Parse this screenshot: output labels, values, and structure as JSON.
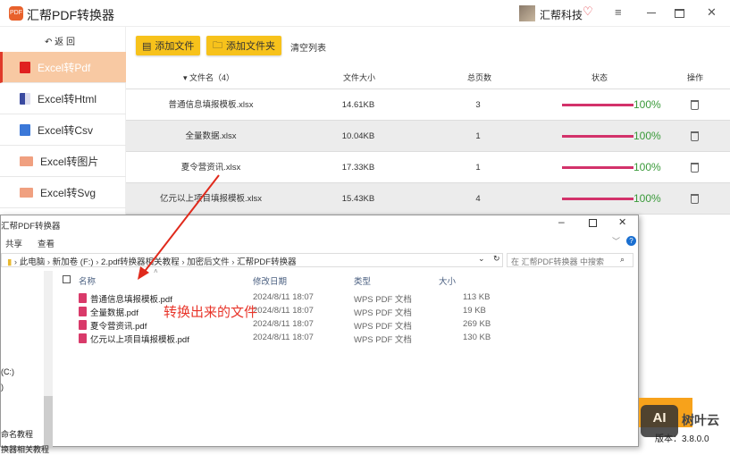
{
  "app": {
    "title": "汇帮PDF转换器",
    "logo_text": "PDF",
    "user": "汇帮科技",
    "back": "返 回"
  },
  "sidebar": {
    "items": [
      {
        "label": "Excel转Pdf",
        "selected": true
      },
      {
        "label": "Excel转Html"
      },
      {
        "label": "Excel转Csv"
      },
      {
        "label": "Excel转图片"
      },
      {
        "label": "Excel转Svg"
      }
    ]
  },
  "toolbar": {
    "add_file": "添加文件",
    "add_folder": "添加文件夹",
    "clear": "清空列表"
  },
  "table": {
    "headers": {
      "name": "▾ 文件名（4）",
      "size": "文件大小",
      "pages": "总页数",
      "status": "状态",
      "action": "操作"
    },
    "rows": [
      {
        "name": "普通信息填报模板.xlsx",
        "size": "14.61KB",
        "pages": "3",
        "progress": "100%"
      },
      {
        "name": "全量数据.xlsx",
        "size": "10.04KB",
        "pages": "1",
        "progress": "100%"
      },
      {
        "name": "夏令营资讯.xlsx",
        "size": "17.33KB",
        "pages": "1",
        "progress": "100%"
      },
      {
        "name": "亿元以上项目填报模板.xlsx",
        "size": "15.43KB",
        "pages": "4",
        "progress": "100%"
      }
    ]
  },
  "explorer": {
    "title": "汇帮PDF转换器",
    "ribbon": [
      "共享",
      "查看"
    ],
    "breadcrumb": [
      "此电脑",
      "新加卷 (F:)",
      "2.pdf转换器相关教程",
      "加密后文件",
      "汇帮PDF转换器"
    ],
    "search_placeholder": "在 汇帮PDF转换器 中搜索",
    "columns": {
      "name": "名称",
      "date": "修改日期",
      "type": "类型",
      "size": "大小"
    },
    "files": [
      {
        "name": "普通信息填报模板.pdf",
        "date": "2024/8/11 18:07",
        "type": "WPS PDF 文档",
        "size": "113 KB"
      },
      {
        "name": "全量数据.pdf",
        "date": "2024/8/11 18:07",
        "type": "WPS PDF 文档",
        "size": "19 KB"
      },
      {
        "name": "夏令营资讯.pdf",
        "date": "2024/8/11 18:07",
        "type": "WPS PDF 文档",
        "size": "269 KB"
      },
      {
        "name": "亿元以上项目填报模板.pdf",
        "date": "2024/8/11 18:07",
        "type": "WPS PDF 文档",
        "size": "130 KB"
      }
    ],
    "nav": [
      "(C:)",
      ")",
      "命名教程",
      "换器相关教程"
    ]
  },
  "annotation": "转换出来的文件",
  "footer": {
    "version": "版本：3.8.0.0",
    "watermark": "AI 树叶云"
  }
}
